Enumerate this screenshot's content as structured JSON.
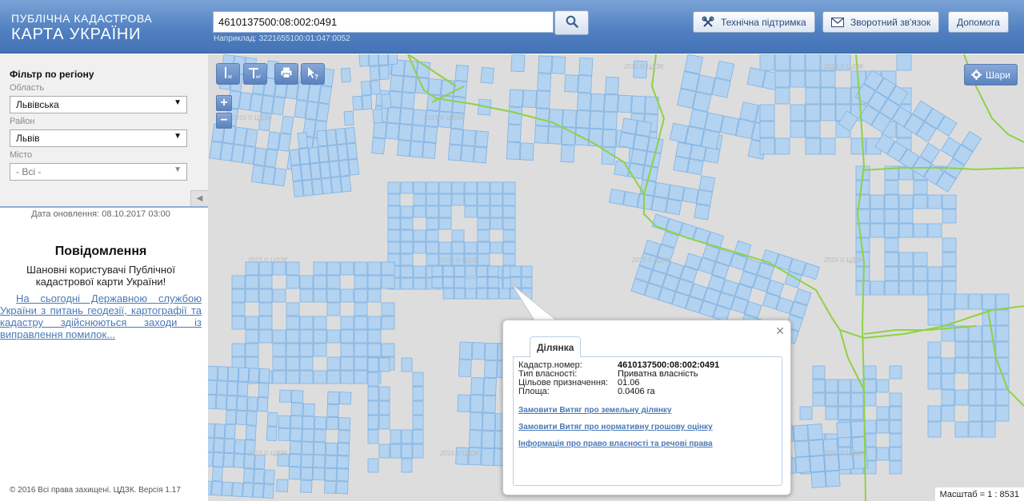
{
  "header": {
    "brand_line1": "ПУБЛІЧНА КАДАСТРОВА",
    "brand_line2": "КАРТА УКРАЇНИ",
    "search_value": "4610137500:08:002:0491",
    "search_hint": "Наприклад: 3221655100:01:047:0052",
    "support_label": "Технічна підтримка",
    "feedback_label": "Зворотний зв'язок",
    "help_label": "Допомога"
  },
  "sidebar": {
    "filter_title": "Фільтр по регіону",
    "oblast_label": "Область",
    "oblast_value": "Львівська",
    "rayon_label": "Район",
    "rayon_value": "Львів",
    "city_label": "Місто",
    "city_value": "- Всі -",
    "updated": "Дата оновлення: 08.10.2017 03:00",
    "news_title": "Повідомлення",
    "news_text": "Шановні користувачі Публічної кадастрової карти України!",
    "news_link": "На сьогодні Державною службою України з питань геодезії, картографії та кадастру здійснюються заходи із виправлення помилок...",
    "copyright": "© 2016 Всі права захищені. ЦДЗК. Версія 1.17"
  },
  "map": {
    "layers_label": "Шари",
    "scale_text": "Масштаб = 1 : 8531",
    "watermark": "2015 © ЦДЗК",
    "tools": [
      "ruler-m-icon",
      "ruler-area-icon",
      "print-icon",
      "identify-icon"
    ],
    "colors": {
      "parcel_fill": "#b3d3f0",
      "parcel_stroke": "#7fb2e3",
      "boundary": "#8fd146",
      "map_bg": "#dddddd"
    }
  },
  "popup": {
    "tab_label": "Ділянка",
    "rows": [
      {
        "key": "Кадастр.номер:",
        "value": "4610137500:08:002:0491"
      },
      {
        "key": "Тип власності:",
        "value": "Приватна власність"
      },
      {
        "key": "Цільове призначення:",
        "value": "01.06"
      },
      {
        "key": "Площа:",
        "value": "0.0406 га"
      }
    ],
    "links": [
      "Замовити Витяг про земельну ділянку",
      "Замовити Витяг про нормативну грошову оцінку",
      "Інформація про право власності та речові права"
    ]
  }
}
